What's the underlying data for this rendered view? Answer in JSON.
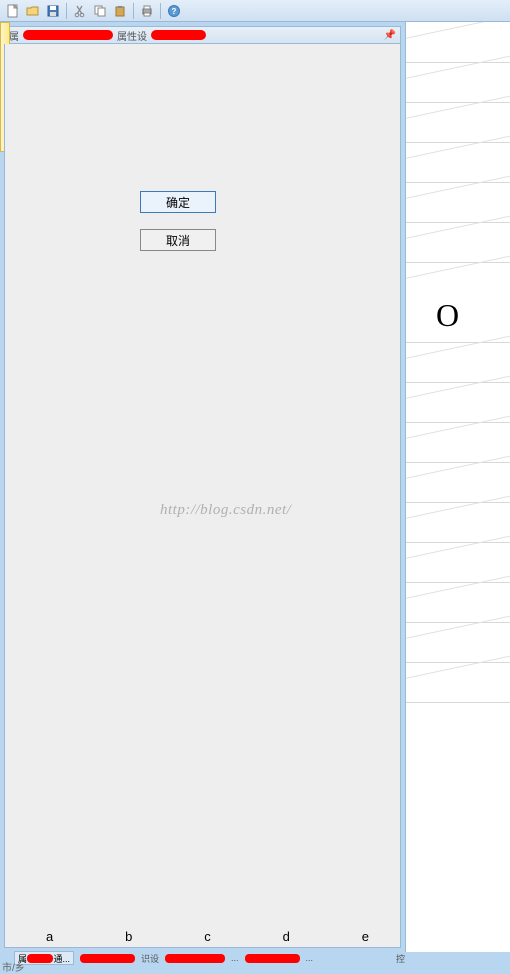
{
  "toolbar": {
    "icons": [
      "new-file-icon",
      "open-folder-icon",
      "save-icon",
      "cut-icon",
      "copy-icon",
      "paste-icon",
      "print-icon",
      "help-icon"
    ]
  },
  "panel": {
    "pin_title": "📌"
  },
  "buttons": {
    "ok": "确定",
    "cancel": "取消"
  },
  "watermark": "http://blog.csdn.net/",
  "right": {
    "symbol": "O"
  },
  "bottom_letters": [
    "a",
    "b",
    "c",
    "d",
    "e"
  ],
  "corner": "市/乡"
}
